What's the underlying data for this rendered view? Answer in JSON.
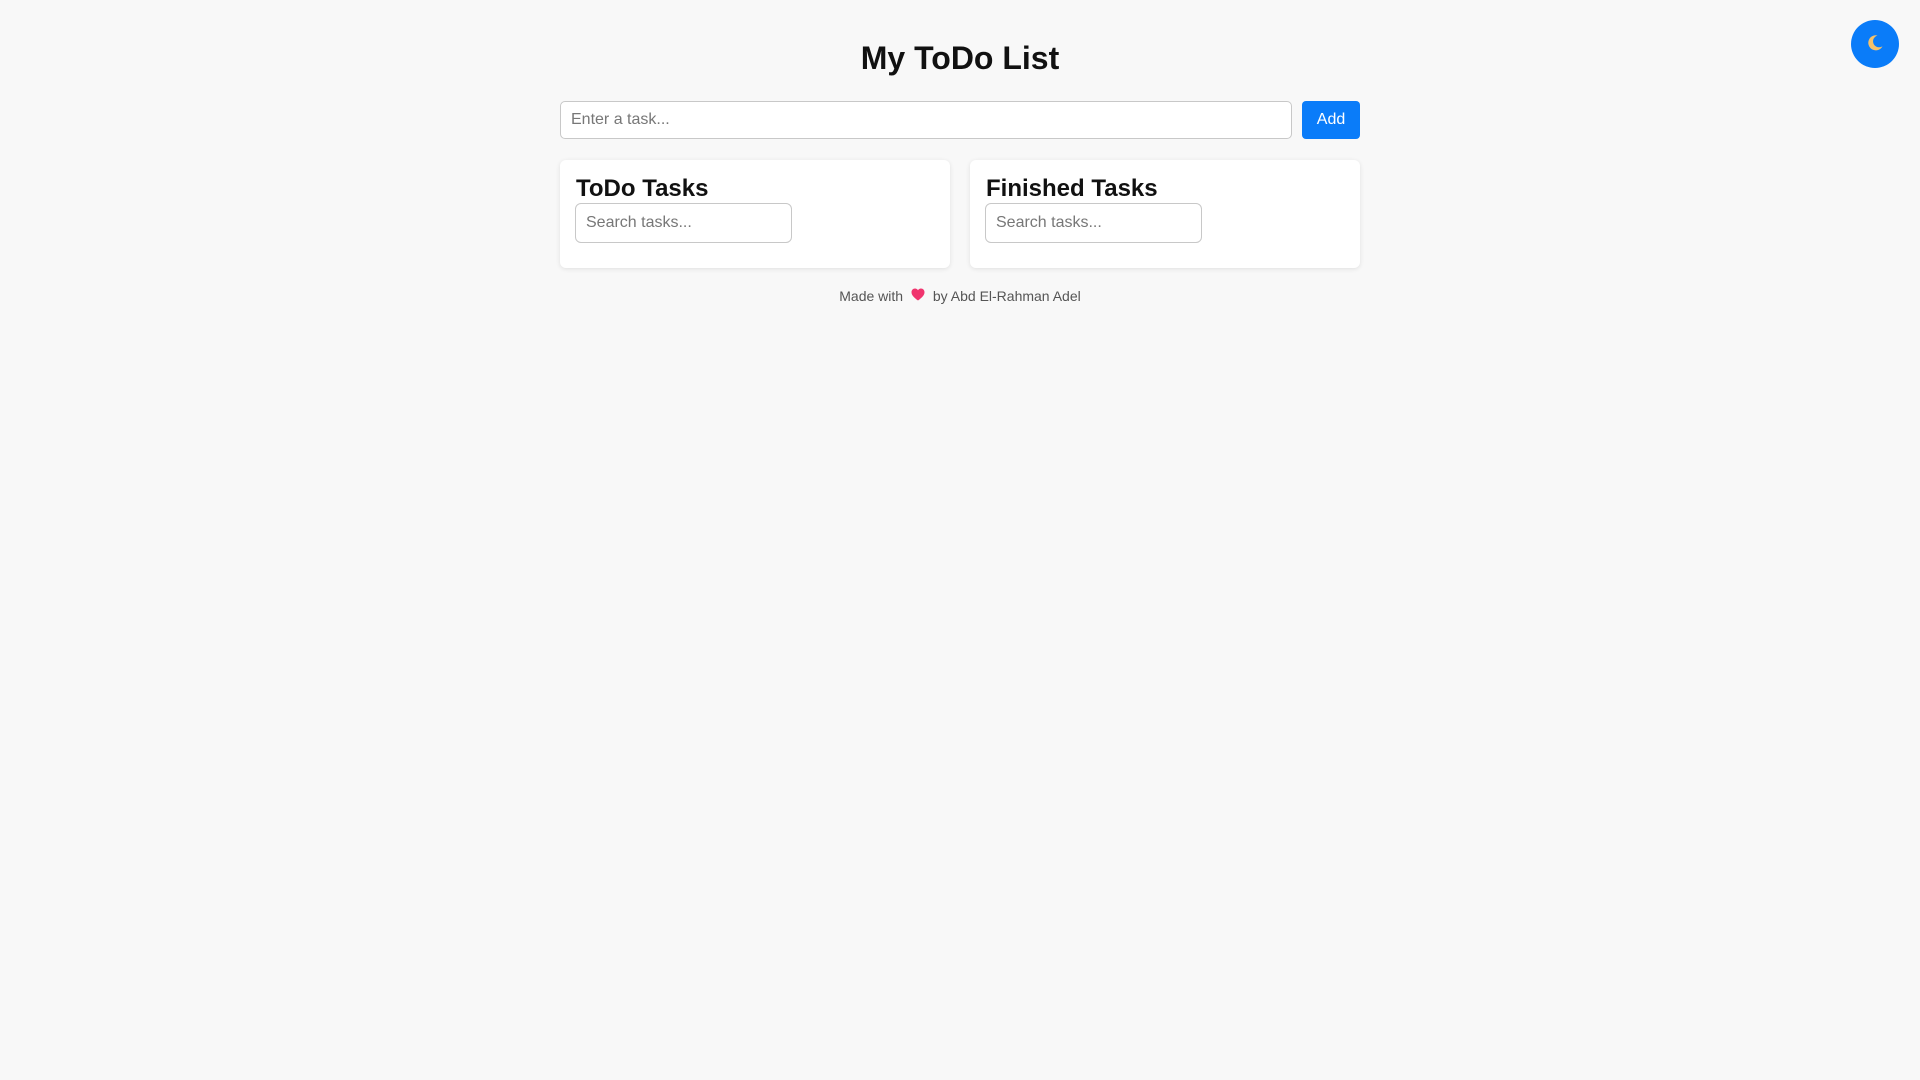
{
  "header": {
    "title": "My ToDo List",
    "theme_toggle_icon": "moon-icon"
  },
  "add_task": {
    "placeholder": "Enter a task...",
    "button_label": "Add"
  },
  "todo_panel": {
    "title": "ToDo Tasks",
    "search_placeholder": "Search tasks..."
  },
  "finished_panel": {
    "title": "Finished Tasks",
    "search_placeholder": "Search tasks..."
  },
  "footer": {
    "prefix": "Made with",
    "suffix": "by Abd El-Rahman Adel",
    "icon": "heart-icon"
  },
  "colors": {
    "accent": "#0a7cf9",
    "background": "#f8f8f8",
    "heart": "#f0346e"
  }
}
